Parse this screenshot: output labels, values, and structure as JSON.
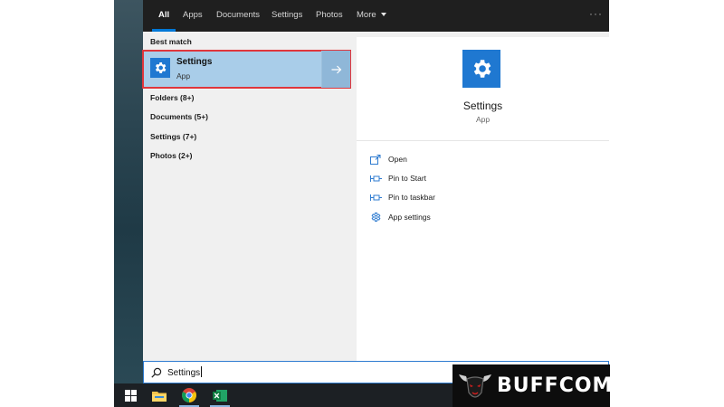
{
  "tabs": [
    {
      "label": "All",
      "active": true
    },
    {
      "label": "Apps"
    },
    {
      "label": "Documents"
    },
    {
      "label": "Settings"
    },
    {
      "label": "Photos"
    },
    {
      "label": "More"
    }
  ],
  "overflow_label": "···",
  "left_pane": {
    "section_title": "Best match",
    "best_match": {
      "name": "Settings",
      "type": "App",
      "icon": "gear-icon",
      "arrow_icon": "arrow-right-icon"
    },
    "categories": [
      {
        "label": "Folders (8+)"
      },
      {
        "label": "Documents (5+)"
      },
      {
        "label": "Settings (7+)"
      },
      {
        "label": "Photos (2+)"
      }
    ]
  },
  "right_pane": {
    "title": "Settings",
    "subtitle": "App",
    "icon": "gear-icon",
    "actions": [
      {
        "label": "Open",
        "icon": "open-icon"
      },
      {
        "label": "Pin to Start",
        "icon": "pin-icon"
      },
      {
        "label": "Pin to taskbar",
        "icon": "pin-icon"
      },
      {
        "label": "App settings",
        "icon": "gear-icon"
      }
    ]
  },
  "search": {
    "value": "Settings",
    "icon": "search-icon"
  },
  "taskbar": {
    "items": [
      "windows-start-icon",
      "file-explorer-icon",
      "chrome-icon",
      "excel-icon"
    ]
  },
  "watermark": {
    "text": "BUFFCOM"
  },
  "colors": {
    "accent": "#0078d7",
    "highlight": "#a9cde9",
    "highlight_border": "#e0363c",
    "tile": "#1f78d1"
  }
}
